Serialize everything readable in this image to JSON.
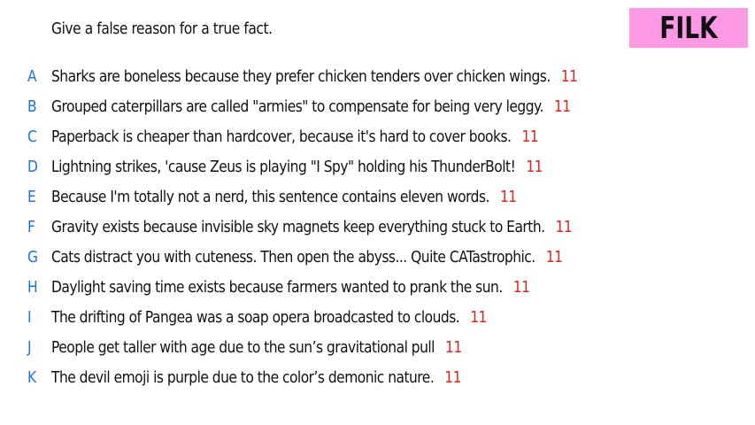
{
  "prompt": "Give a false reason for a true fact.",
  "logo": {
    "text": "FILK",
    "background": "#ff99e6"
  },
  "colors": {
    "letter": "#1a73e8",
    "score": "#e8221c",
    "text": "#111111"
  },
  "answers": [
    {
      "letter": "A",
      "text": "Sharks are boneless because they prefer chicken tenders over chicken wings.",
      "score": "11"
    },
    {
      "letter": "B",
      "text": "Grouped caterpillars are called \"armies\" to compensate for being very leggy.",
      "score": "11"
    },
    {
      "letter": "C",
      "text": "Paperback is cheaper than hardcover, because it's hard to cover books.",
      "score": "11"
    },
    {
      "letter": "D",
      "text": "Lightning strikes, 'cause Zeus is playing \"I Spy\" holding his ThunderBolt!",
      "score": "11"
    },
    {
      "letter": "E",
      "text": "Because I'm totally not a nerd, this sentence contains eleven words.",
      "score": "11"
    },
    {
      "letter": "F",
      "text": "Gravity exists because invisible sky magnets keep everything stuck to Earth.",
      "score": "11"
    },
    {
      "letter": "G",
      "text": "Cats distract you with cuteness. Then open the abyss... Quite CATastrophic.",
      "score": "11"
    },
    {
      "letter": "H",
      "text": "Daylight saving time exists because farmers wanted to prank the sun.",
      "score": "11"
    },
    {
      "letter": "I",
      "text": "The drifting of Pangea was a soap opera broadcasted to clouds.",
      "score": "11"
    },
    {
      "letter": "J",
      "text": "People get taller with age due to the sun’s gravitational pull",
      "score": "11"
    },
    {
      "letter": "K",
      "text": "The devil emoji is purple due to the color’s demonic nature.",
      "score": "11"
    }
  ]
}
